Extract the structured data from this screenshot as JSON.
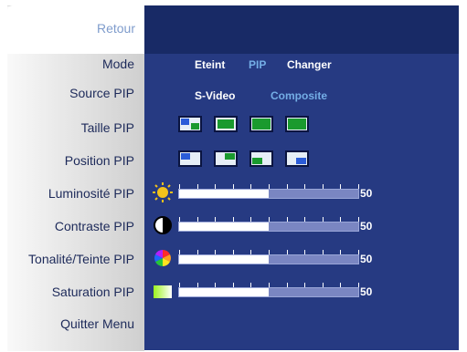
{
  "menu": {
    "back": "Retour",
    "items": [
      "Mode",
      "Source PIP",
      "Taille PIP",
      "Position PIP",
      "Luminosité PIP",
      "Contraste PIP",
      "Tonalité/Teinte PIP",
      "Saturation PIP",
      "Quitter Menu"
    ]
  },
  "mode": {
    "options": [
      "Eteint",
      "PIP",
      "Changer"
    ],
    "selected": "PIP"
  },
  "source": {
    "options": [
      "S-Video",
      "Composite"
    ],
    "selected": "Composite"
  },
  "sliders": {
    "luminosite": {
      "value": 50,
      "icon": "sun-icon"
    },
    "contraste": {
      "value": 50,
      "icon": "contrast-icon"
    },
    "teinte": {
      "value": 50,
      "icon": "color-wheel-icon"
    },
    "saturation": {
      "value": 50,
      "icon": "saturation-gradient-icon"
    }
  },
  "colors": {
    "panel": "#263a82",
    "header": "#182a66",
    "selected": "#74aee6",
    "menu_text": "#1d2a5a"
  }
}
